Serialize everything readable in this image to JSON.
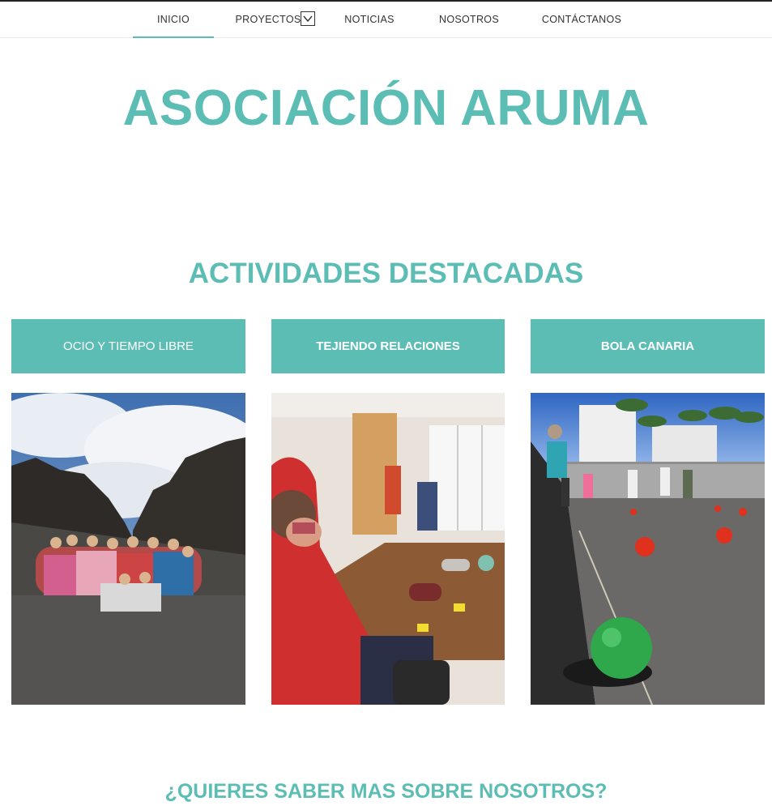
{
  "nav": {
    "items": [
      {
        "label": "INICIO"
      },
      {
        "label": "PROYECTOS"
      },
      {
        "label": "NOTICIAS"
      },
      {
        "label": "NOSOTROS"
      },
      {
        "label": "CONTÁCTANOS"
      }
    ],
    "active_index": 0
  },
  "hero": {
    "title": "ASOCIACIÓN ARUMA"
  },
  "activities": {
    "title": "ACTIVIDADES DESTACADAS",
    "cards": [
      {
        "label": "OCIO Y TIEMPO LIBRE",
        "photo": "group hiking photo in volcanic landscape"
      },
      {
        "label": "TEJIENDO RELACIONES",
        "photo": "knitting workshop photo"
      },
      {
        "label": "BOLA CANARIA",
        "photo": "bola canaria game photo"
      }
    ]
  },
  "about": {
    "title": "¿QUIERES SABER MAS SOBRE NOSOTROS?"
  },
  "colors": {
    "accent": "#5cbdb5",
    "text": "#333333"
  }
}
